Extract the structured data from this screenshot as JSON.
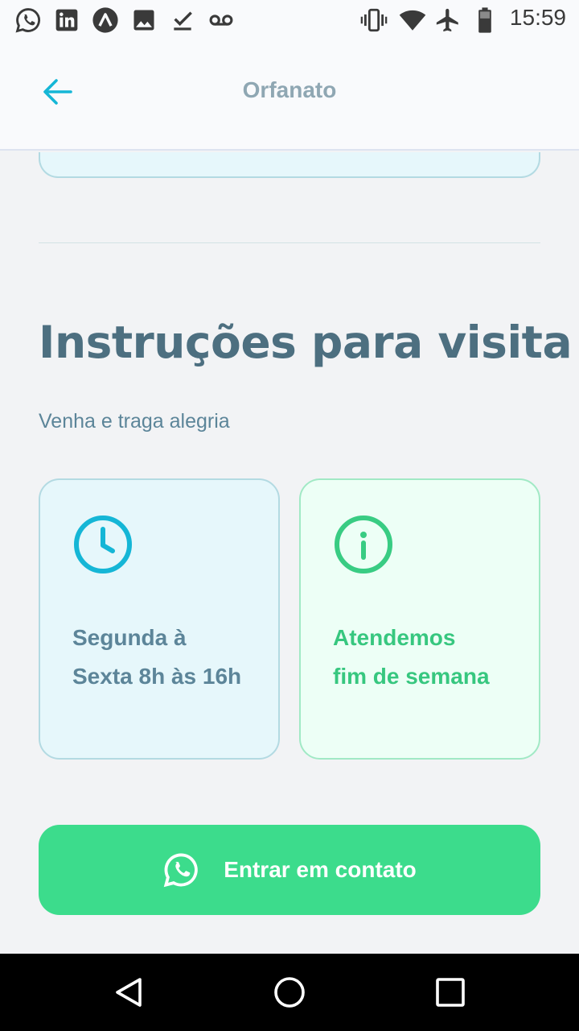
{
  "status_bar": {
    "time": "15:59",
    "left_icons": [
      "whatsapp-icon",
      "linkedin-icon",
      "arch-icon",
      "image-icon",
      "download-done-icon",
      "voicemail-icon"
    ],
    "right_icons": [
      "vibrate-icon",
      "wifi-icon",
      "airplane-icon",
      "battery-icon"
    ]
  },
  "header": {
    "title": "Orfanato",
    "back_icon": "arrow-left-icon",
    "accent_color": "#15b6d6"
  },
  "instructions": {
    "title": "Instruções para visita",
    "subtitle": "Venha e traga alegria"
  },
  "cards": {
    "hours": {
      "icon": "clock-icon",
      "text": "Segunda à Sexta 8h às 16h",
      "color": "#15b6d6"
    },
    "weekend": {
      "icon": "info-icon",
      "line1": "Atendemos",
      "line2": "fim de semana",
      "color": "#39cc83"
    }
  },
  "contact_button": {
    "label": "Entrar em contato",
    "icon": "whatsapp-icon",
    "color": "#3cdc8c"
  },
  "nav_bar": {
    "buttons": [
      "back-triangle-icon",
      "home-circle-icon",
      "recents-square-icon"
    ]
  }
}
